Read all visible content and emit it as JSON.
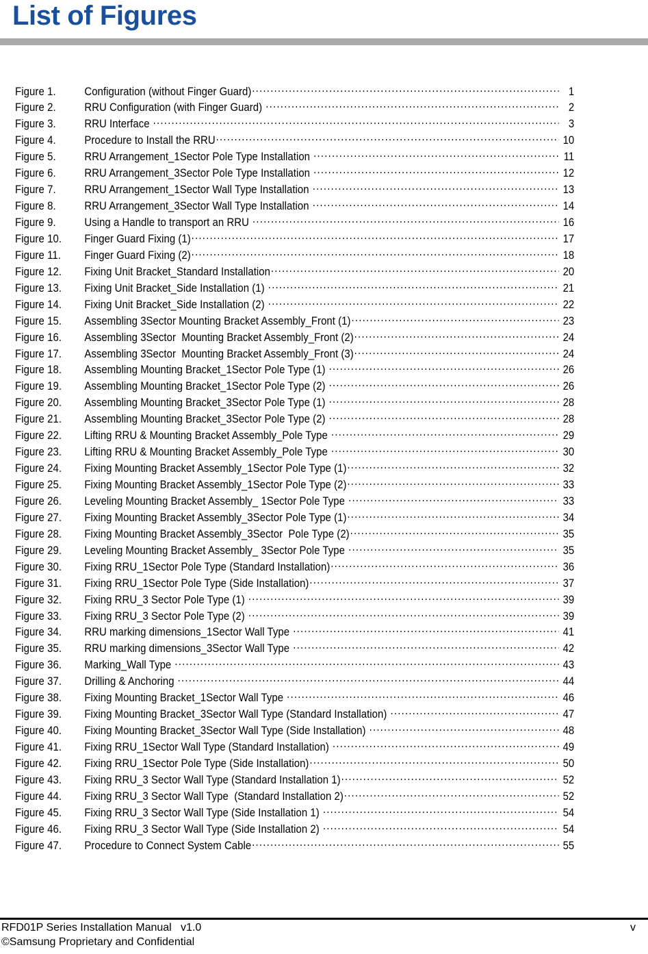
{
  "document": {
    "title": "List of Figures",
    "title_color": "#1a4f9c",
    "rule_color": "#a9a9a9"
  },
  "toc": {
    "entries": [
      {
        "label": "Figure 1.",
        "caption": "Configuration (without Finger Guard)",
        "page": "1"
      },
      {
        "label": "Figure 2.",
        "caption": "RRU Configuration (with Finger Guard) ",
        "page": "2"
      },
      {
        "label": "Figure 3.",
        "caption": "RRU Interface ",
        "page": "3"
      },
      {
        "label": "Figure 4.",
        "caption": "Procedure to Install the RRU",
        "page": "10"
      },
      {
        "label": "Figure 5.",
        "caption": "RRU Arrangement_1Sector Pole Type Installation ",
        "page": "11"
      },
      {
        "label": "Figure 6.",
        "caption": "RRU Arrangement_3Sector Pole Type Installation ",
        "page": "12"
      },
      {
        "label": "Figure 7.",
        "caption": "RRU Arrangement_1Sector Wall Type Installation ",
        "page": "13"
      },
      {
        "label": "Figure 8.",
        "caption": "RRU Arrangement_3Sector Wall Type Installation ",
        "page": "14"
      },
      {
        "label": "Figure 9.",
        "caption": "Using a Handle to transport an RRU ",
        "page": "16"
      },
      {
        "label": "Figure 10.",
        "caption": "Finger Guard Fixing (1)",
        "page": "17"
      },
      {
        "label": "Figure 11.",
        "caption": "Finger Guard Fixing (2)",
        "page": "18"
      },
      {
        "label": "Figure 12.",
        "caption": "Fixing Unit Bracket_Standard Installation",
        "page": "20"
      },
      {
        "label": "Figure 13.",
        "caption": "Fixing Unit Bracket_Side Installation (1) ",
        "page": "21"
      },
      {
        "label": "Figure 14.",
        "caption": "Fixing Unit Bracket_Side Installation (2) ",
        "page": "22"
      },
      {
        "label": "Figure 15.",
        "caption": "Assembling 3Sector Mounting Bracket Assembly_Front (1)",
        "page": "23"
      },
      {
        "label": "Figure 16.",
        "caption": "Assembling 3Sector  Mounting Bracket Assembly_Front (2)",
        "page": "24"
      },
      {
        "label": "Figure 17.",
        "caption": "Assembling 3Sector  Mounting Bracket Assembly_Front (3)",
        "page": "24"
      },
      {
        "label": "Figure 18.",
        "caption": "Assembling Mounting Bracket_1Sector Pole Type (1) ",
        "page": "26"
      },
      {
        "label": "Figure 19.",
        "caption": "Assembling Mounting Bracket_1Sector Pole Type (2) ",
        "page": "26"
      },
      {
        "label": "Figure 20.",
        "caption": "Assembling Mounting Bracket_3Sector Pole Type (1) ",
        "page": "28"
      },
      {
        "label": "Figure 21.",
        "caption": "Assembling Mounting Bracket_3Sector Pole Type (2) ",
        "page": "28"
      },
      {
        "label": "Figure 22.",
        "caption": "Lifting RRU & Mounting Bracket Assembly_Pole Type ",
        "page": "29"
      },
      {
        "label": "Figure 23.",
        "caption": "Lifting RRU & Mounting Bracket Assembly_Pole Type ",
        "page": "30"
      },
      {
        "label": "Figure 24.",
        "caption": "Fixing Mounting Bracket Assembly_1Sector Pole Type (1)",
        "page": "32"
      },
      {
        "label": "Figure 25.",
        "caption": "Fixing Mounting Bracket Assembly_1Sector Pole Type (2)",
        "page": "33"
      },
      {
        "label": "Figure 26.",
        "caption": "Leveling Mounting Bracket Assembly_ 1Sector Pole Type ",
        "page": "33"
      },
      {
        "label": "Figure 27.",
        "caption": "Fixing Mounting Bracket Assembly_3Sector Pole Type (1)",
        "page": "34"
      },
      {
        "label": "Figure 28.",
        "caption": "Fixing Mounting Bracket Assembly_3Sector  Pole Type (2)",
        "page": "35"
      },
      {
        "label": "Figure 29.",
        "caption": "Leveling Mounting Bracket Assembly_ 3Sector Pole Type ",
        "page": "35"
      },
      {
        "label": "Figure 30.",
        "caption": "Fixing RRU_1Sector Pole Type (Standard Installation)",
        "page": "36"
      },
      {
        "label": "Figure 31.",
        "caption": "Fixing RRU_1Sector Pole Type (Side Installation)",
        "page": "37"
      },
      {
        "label": "Figure 32.",
        "caption": "Fixing RRU_3 Sector Pole Type (1) ",
        "page": "39"
      },
      {
        "label": "Figure 33.",
        "caption": "Fixing RRU_3 Sector Pole Type (2) ",
        "page": "39"
      },
      {
        "label": "Figure 34.",
        "caption": "RRU marking dimensions_1Sector Wall Type ",
        "page": "41"
      },
      {
        "label": "Figure 35.",
        "caption": "RRU marking dimensions_3Sector Wall Type ",
        "page": "42"
      },
      {
        "label": "Figure 36.",
        "caption": "Marking_Wall Type ",
        "page": "43"
      },
      {
        "label": "Figure 37.",
        "caption": "Drilling & Anchoring ",
        "page": "44"
      },
      {
        "label": "Figure 38.",
        "caption": "Fixing Mounting Bracket_1Sector Wall Type ",
        "page": "46"
      },
      {
        "label": "Figure 39.",
        "caption": "Fixing Mounting Bracket_3Sector Wall Type (Standard Installation) ",
        "page": "47"
      },
      {
        "label": "Figure 40.",
        "caption": "Fixing Mounting Bracket_3Sector Wall Type (Side Installation) ",
        "page": "48"
      },
      {
        "label": "Figure 41.",
        "caption": "Fixing RRU_1Sector Wall Type (Standard Installation) ",
        "page": "49"
      },
      {
        "label": "Figure 42.",
        "caption": "Fixing RRU_1Sector Pole Type (Side Installation)",
        "page": "50"
      },
      {
        "label": "Figure 43.",
        "caption": "Fixing RRU_3 Sector Wall Type (Standard Installation 1)",
        "page": "52"
      },
      {
        "label": "Figure 44.",
        "caption": "Fixing RRU_3 Sector Wall Type  (Standard Installation 2)",
        "page": "52"
      },
      {
        "label": "Figure 45.",
        "caption": "Fixing RRU_3 Sector Wall Type (Side Installation 1) ",
        "page": "54"
      },
      {
        "label": "Figure 46.",
        "caption": "Fixing RRU_3 Sector Wall Type (Side Installation 2) ",
        "page": "54"
      },
      {
        "label": "Figure 47.",
        "caption": "Procedure to Connect System Cable",
        "page": "55"
      }
    ]
  },
  "footer": {
    "manual_title": "RFD01P Series Installation Manual   v1.0",
    "confidentiality": "©Samsung Proprietary and Confidential",
    "page_number": "v"
  }
}
